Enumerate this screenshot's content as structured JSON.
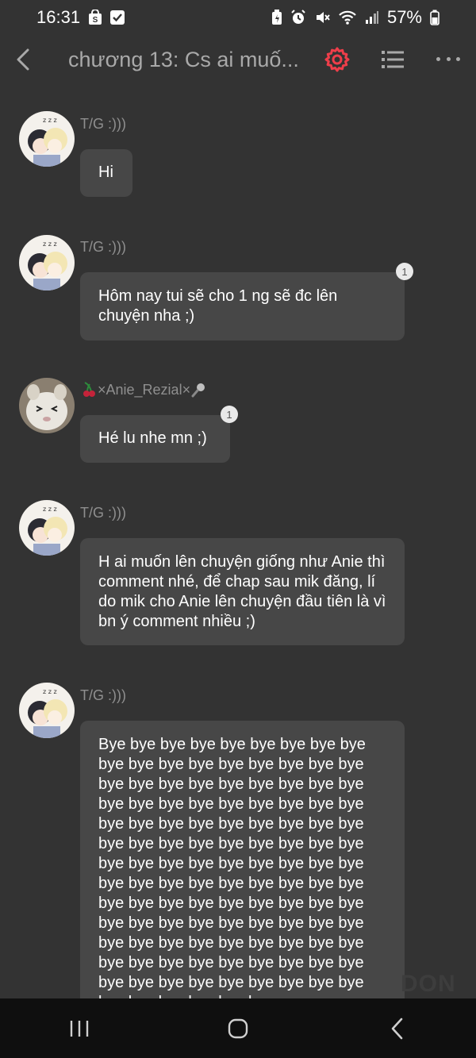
{
  "status_bar": {
    "time": "16:31",
    "battery": "57%",
    "left_icons": [
      "shopping-bag-icon",
      "checkbox-icon"
    ],
    "right_icons": [
      "battery-saver-icon",
      "alarm-icon",
      "mute-icon",
      "wifi-icon",
      "signal-icon",
      "battery-icon"
    ]
  },
  "app_bar": {
    "title": "chương 13: Cs ai muố...",
    "accent_color": "#ef3e4a"
  },
  "messages": [
    {
      "sender": "T/G :)))",
      "text": "Hi",
      "badge": ""
    },
    {
      "sender": "T/G :)))",
      "text": "Hôm nay tui sẽ cho 1 ng sẽ đc lên chuyện nha ;)",
      "badge": "1"
    },
    {
      "sender": "×Anie_Rezial×",
      "text": "Hé lu nhe mn ;)",
      "badge": "1"
    },
    {
      "sender": "T/G :)))",
      "text": "H ai muốn lên chuyện giống như Anie thì comment nhé, để chap sau mik đăng, lí do mik cho Anie lên chuyện đầu tiên là vì bn ý comment nhiều ;)",
      "badge": ""
    },
    {
      "sender": "T/G :)))",
      "text": "Bye bye bye bye bye bye bye bye bye bye bye bye bye bye bye bye bye bye bye bye bye bye bye bye bye bye bye bye bye bye bye bye bye bye bye bye bye bye bye bye bye bye bye bye bye bye bye bye bye bye bye bye bye bye bye bye bye bye bye bye bye bye bye bye bye bye bye bye bye bye bye bye bye bye bye bye bye bye bye bye bye bye bye bye bye bye bye bye bye bye bye bye bye bye bye bye bye bye bye bye bye bye bye bye bye bye bye bye bye bye bye bye bye bye bye bye bye bye bye bye bye bye bye",
      "badge": ""
    }
  ],
  "watermark": "DON"
}
